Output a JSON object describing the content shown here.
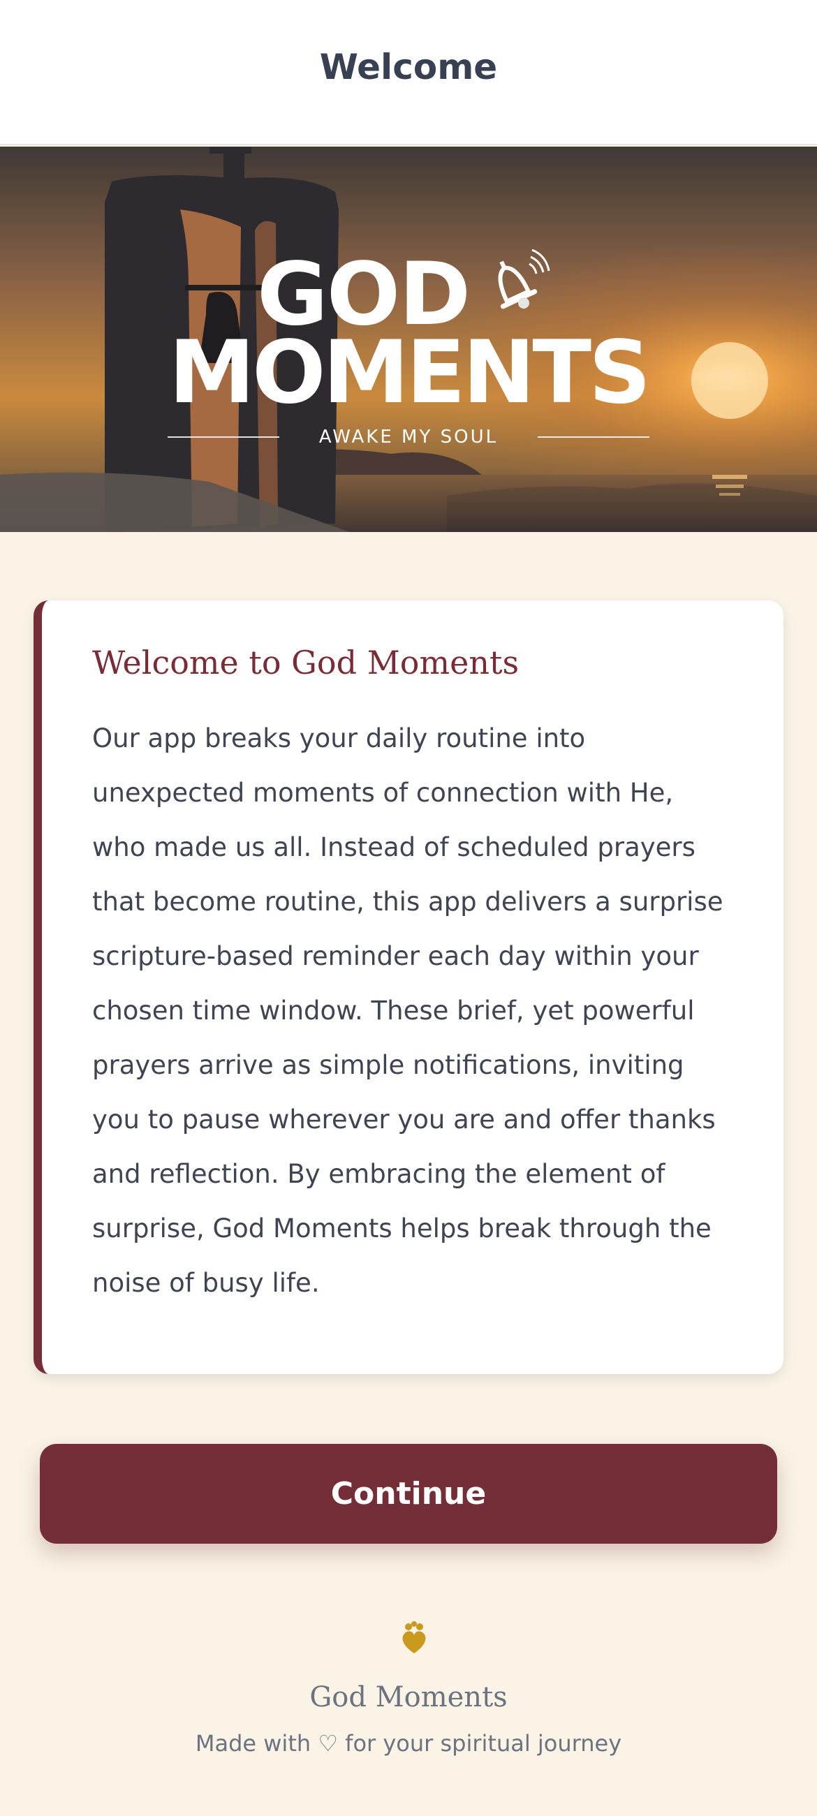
{
  "header": {
    "title": "Welcome"
  },
  "hero": {
    "logo_line1": "GOD",
    "logo_line2": "MOMENTS",
    "tagline": "AWAKE MY SOUL",
    "bell_icon": "bell-ringing-icon"
  },
  "card": {
    "title": "Welcome to God Moments",
    "body": "Our app breaks your daily routine into unexpected moments of connection with He, who made us all. Instead of scheduled prayers that become routine, this app delivers a surprise scripture-based reminder each day within your chosen time window. These brief, yet powerful prayers arrive as simple notifications, inviting you to pause wherever you are and offer thanks and reflection. By embracing the element of surprise, God Moments helps break through the noise of busy life.",
    "accent_color": "#742e37"
  },
  "actions": {
    "continue_label": "Continue"
  },
  "footer": {
    "icon": "heart-flower-icon",
    "title": "God Moments",
    "subtitle": "Made with ♡ for your spiritual journey"
  }
}
